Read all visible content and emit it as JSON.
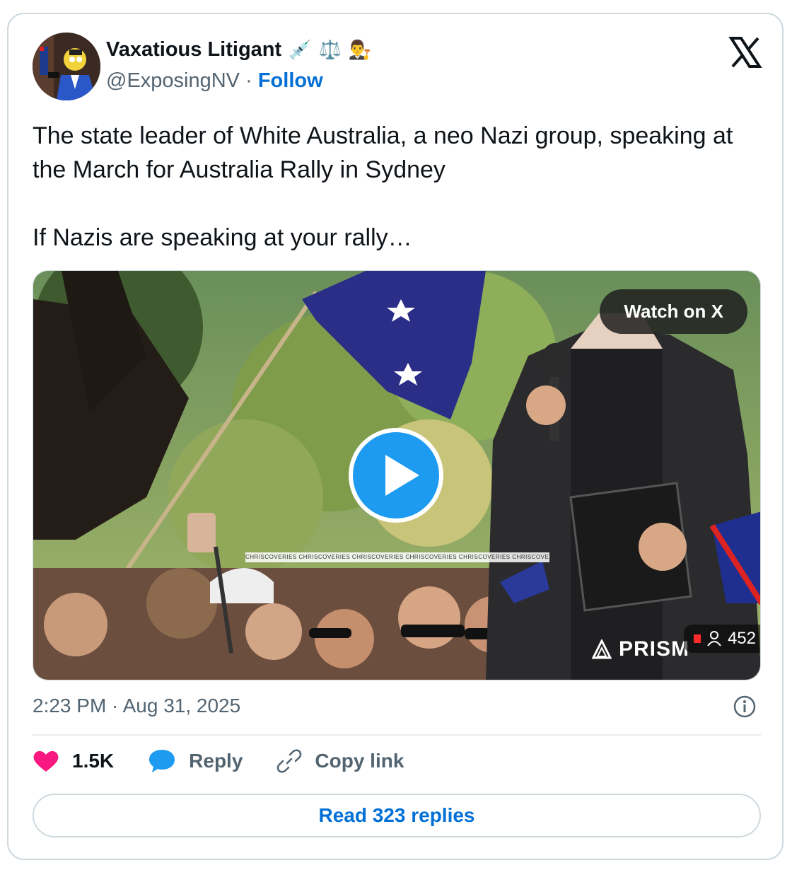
{
  "author": {
    "name": "Vaxatious Litigant",
    "emojis": [
      "💉",
      "⚖️",
      "👨‍⚖️"
    ],
    "handle": "@ExposingNV",
    "separator": "·",
    "follow_label": "Follow"
  },
  "tweet": {
    "text": "The state leader of White Australia, a neo Nazi group, speaking at the March for Australia Rally in Sydney\n\nIf Nazis are speaking at your rally…",
    "timestamp": "2:23 PM · Aug 31, 2025"
  },
  "media": {
    "watch_label": "Watch on X",
    "viewer_count": "452",
    "watermark_text": "CHRISCOVERIES CHRISCOVERIES CHRISCOVERIES CHRISCOVERIES CHRISCOVERIES CHRISCOVERIES CH",
    "stream_brand": "PRISM",
    "play_icon": "play-icon"
  },
  "actions": {
    "likes": "1.5K",
    "reply_label": "Reply",
    "copy_link_label": "Copy link"
  },
  "read_replies_label": "Read 323 replies",
  "colors": {
    "accent": "#1d9bf0",
    "link": "#006fd6",
    "like": "#f91880",
    "muted": "#536471",
    "border": "#cfd9de"
  }
}
